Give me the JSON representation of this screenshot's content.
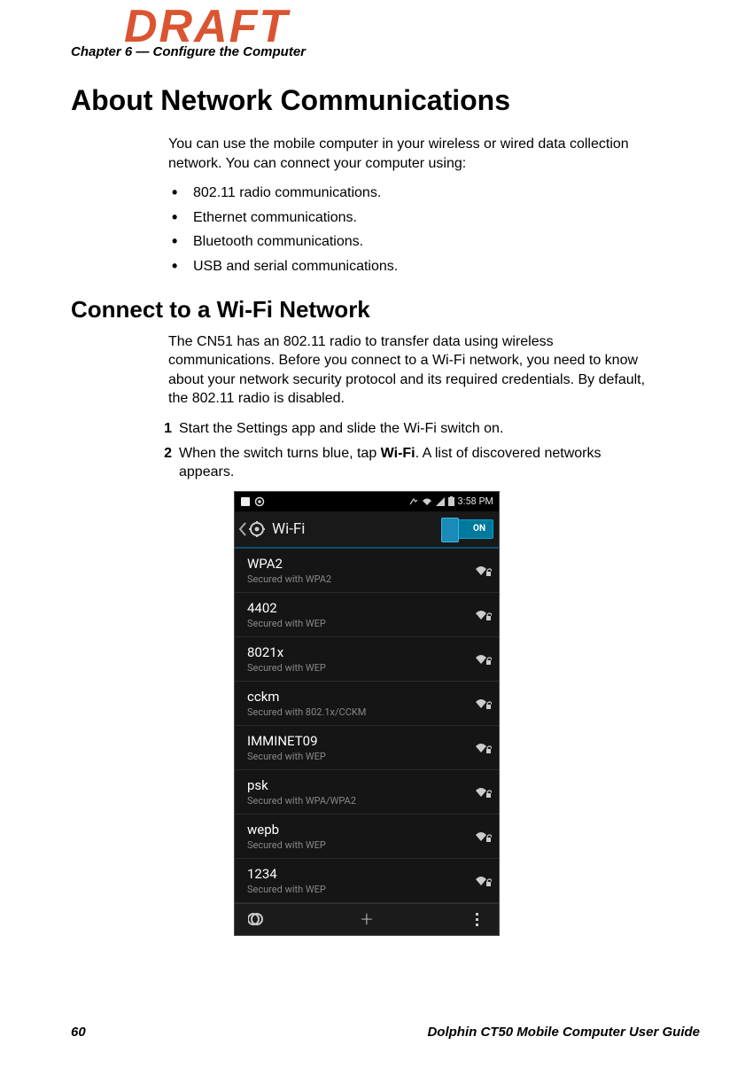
{
  "watermark": "DRAFT",
  "chapter_header": "Chapter 6 — Configure the Computer",
  "heading1": "About Network Communications",
  "intro": "You can use the mobile computer in your wireless or wired data collection network. You can connect your computer using:",
  "bullets": [
    "802.11 radio communications.",
    "Ethernet communications.",
    "Bluetooth communications.",
    "USB and serial communications."
  ],
  "heading2": "Connect to a Wi-Fi Network",
  "wifi_intro": "The CN51 has an 802.11 radio to transfer data using wireless communications. Before you connect to a Wi-Fi network, you need to know about your network security protocol and its required credentials. By default, the 802.11 radio is disabled.",
  "steps": [
    "Start the Settings app and slide the Wi-Fi switch on.",
    {
      "pre": "When the switch turns blue, tap ",
      "bold": "Wi-Fi",
      "post": ". A list of discovered networks appears."
    }
  ],
  "phone": {
    "status_time": "3:58 PM",
    "title": "Wi-Fi",
    "toggle_label": "ON",
    "networks": [
      {
        "ssid": "WPA2",
        "sub": "Secured with WPA2"
      },
      {
        "ssid": "4402",
        "sub": "Secured with WEP"
      },
      {
        "ssid": "8021x",
        "sub": "Secured with WEP"
      },
      {
        "ssid": "cckm",
        "sub": "Secured with 802.1x/CCKM"
      },
      {
        "ssid": "IMMINET09",
        "sub": "Secured with WEP"
      },
      {
        "ssid": "psk",
        "sub": "Secured with WPA/WPA2"
      },
      {
        "ssid": "wepb",
        "sub": "Secured with WEP"
      },
      {
        "ssid": "1234",
        "sub": "Secured with WEP"
      }
    ]
  },
  "footer": {
    "page": "60",
    "guide": "Dolphin CT50 Mobile Computer User Guide"
  }
}
